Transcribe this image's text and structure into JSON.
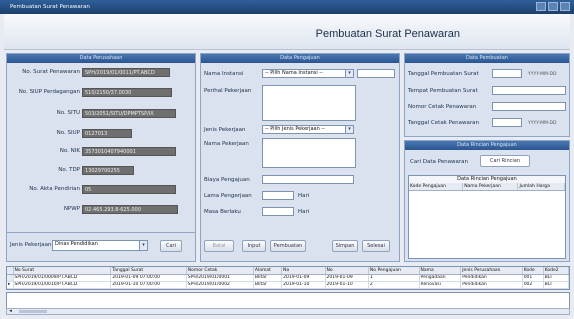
{
  "window": {
    "title": "Pembuatan Surat Penawaran"
  },
  "header": {
    "title": "Pembuatan Surat Penawaran"
  },
  "panels": {
    "left_title": "Data Perusahaan",
    "middle_title": "Data Pengajuan",
    "right_title": "Data Pembuatan",
    "right2_title": "Data Rincian Pengajuan"
  },
  "left": {
    "fields": [
      {
        "label": "No. Surat Penawaran",
        "value": "SPH/2019/01/0011/PT.ABCD"
      },
      {
        "label": "No. SIUP Perdagangan",
        "value": "510/2150/37.0030"
      },
      {
        "label": "No. SITU",
        "value": "503/2051/SITU/DPMPTSP/IX"
      },
      {
        "label": "No. SIUP",
        "value": "0127013"
      },
      {
        "label": "No. NIK",
        "value": "3573010407940001"
      },
      {
        "label": "No. TDP",
        "value": "13029700255"
      },
      {
        "label": "No. Akta Pendirian",
        "value": "05"
      },
      {
        "label": "NPWP",
        "value": "02.465.293.8-625.000"
      }
    ],
    "jenis_label": "Jenis Pekerjaan",
    "jenis_value": "Dinas Pendidikan",
    "jenis_btn": "Cari"
  },
  "middle": {
    "nama_instansi_label": "Nama Instansi",
    "nama_instansi_value": "-- Pilih Nama Instansi --",
    "perihal_label": "Perihal Pekerjaan",
    "jenis_pekerjaan_label": "Jenis Pekerjaan",
    "jenis_pekerjaan_value": "-- Pilih Jenis Pekerjaan --",
    "nama_pekerjaan_label": "Nama Pekerjaan",
    "biaya_label": "Biaya Pengajuan",
    "lama_label": "Lama Pengerjaan",
    "lama_unit": "Hari",
    "masa_label": "Masa Berlaku",
    "masa_unit": "Hari",
    "buttons": [
      "Batal",
      "Input",
      "Pembuatan",
      "Simpan",
      "Selesai"
    ]
  },
  "right": {
    "tgl_label": "Tanggal Pembuatan Surat",
    "tgl_value": "",
    "tgl_hint": "YYYY-MM-DD",
    "tempat_label": "Tempat Pembuatan Surat",
    "nomor_label": "Nomor Cetak Penawaran",
    "tgl_cetak_label": "Tanggal Cetak Penawaran",
    "tgl_cetak_hint": "YYYY-MM-DD",
    "cari_label": "Cari Data Penawaran",
    "cari_btn": "Cari Rincian",
    "grid_title": "Data Rincian Pengajuan",
    "grid_cols": [
      "Kode Pengajuan",
      "Nama Pekerjaan",
      "Jumlah Harga"
    ]
  },
  "bottom_grid": {
    "columns": [
      "No Surat",
      "Tanggal Surat",
      "Nomor Cetak",
      "Alamat",
      "No",
      "No",
      "No Pengajuan",
      "Nama",
      "Jenis Perusahaan",
      "Kode",
      "Kode2"
    ],
    "rows": [
      [
        "SPH/2019/01/0009/PT.ABCD",
        "2019-01-09 07:00:00",
        "SPH/2019/01/0001",
        "Blitar",
        "2019-01-09",
        "2019-01-09",
        "1",
        "Pengadaan",
        "Pendidikan",
        "001",
        "BLT"
      ],
      [
        "SPH/2019/01/0010/PT.ABCD",
        "2019-01-10 07:00:00",
        "SPH/2019/01/0002",
        "Blitar",
        "2019-01-10",
        "2019-01-10",
        "2",
        "Renovasi",
        "Pendidikan",
        "002",
        "BLT"
      ]
    ]
  }
}
